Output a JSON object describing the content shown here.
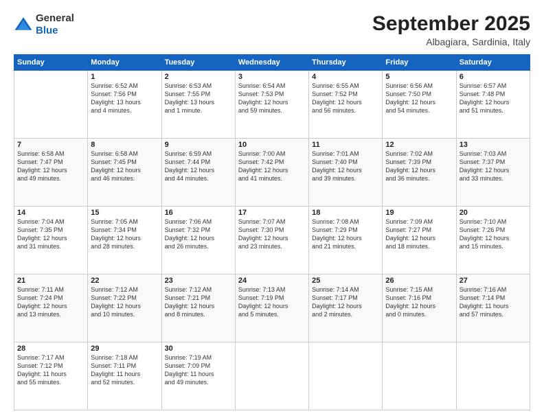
{
  "logo": {
    "line1": "General",
    "line2": "Blue"
  },
  "header": {
    "month": "September 2025",
    "location": "Albagiara, Sardinia, Italy"
  },
  "weekdays": [
    "Sunday",
    "Monday",
    "Tuesday",
    "Wednesday",
    "Thursday",
    "Friday",
    "Saturday"
  ],
  "weeks": [
    [
      {
        "day": "",
        "info": ""
      },
      {
        "day": "1",
        "info": "Sunrise: 6:52 AM\nSunset: 7:56 PM\nDaylight: 13 hours\nand 4 minutes."
      },
      {
        "day": "2",
        "info": "Sunrise: 6:53 AM\nSunset: 7:55 PM\nDaylight: 13 hours\nand 1 minute."
      },
      {
        "day": "3",
        "info": "Sunrise: 6:54 AM\nSunset: 7:53 PM\nDaylight: 12 hours\nand 59 minutes."
      },
      {
        "day": "4",
        "info": "Sunrise: 6:55 AM\nSunset: 7:52 PM\nDaylight: 12 hours\nand 56 minutes."
      },
      {
        "day": "5",
        "info": "Sunrise: 6:56 AM\nSunset: 7:50 PM\nDaylight: 12 hours\nand 54 minutes."
      },
      {
        "day": "6",
        "info": "Sunrise: 6:57 AM\nSunset: 7:48 PM\nDaylight: 12 hours\nand 51 minutes."
      }
    ],
    [
      {
        "day": "7",
        "info": "Sunrise: 6:58 AM\nSunset: 7:47 PM\nDaylight: 12 hours\nand 49 minutes."
      },
      {
        "day": "8",
        "info": "Sunrise: 6:58 AM\nSunset: 7:45 PM\nDaylight: 12 hours\nand 46 minutes."
      },
      {
        "day": "9",
        "info": "Sunrise: 6:59 AM\nSunset: 7:44 PM\nDaylight: 12 hours\nand 44 minutes."
      },
      {
        "day": "10",
        "info": "Sunrise: 7:00 AM\nSunset: 7:42 PM\nDaylight: 12 hours\nand 41 minutes."
      },
      {
        "day": "11",
        "info": "Sunrise: 7:01 AM\nSunset: 7:40 PM\nDaylight: 12 hours\nand 39 minutes."
      },
      {
        "day": "12",
        "info": "Sunrise: 7:02 AM\nSunset: 7:39 PM\nDaylight: 12 hours\nand 36 minutes."
      },
      {
        "day": "13",
        "info": "Sunrise: 7:03 AM\nSunset: 7:37 PM\nDaylight: 12 hours\nand 33 minutes."
      }
    ],
    [
      {
        "day": "14",
        "info": "Sunrise: 7:04 AM\nSunset: 7:35 PM\nDaylight: 12 hours\nand 31 minutes."
      },
      {
        "day": "15",
        "info": "Sunrise: 7:05 AM\nSunset: 7:34 PM\nDaylight: 12 hours\nand 28 minutes."
      },
      {
        "day": "16",
        "info": "Sunrise: 7:06 AM\nSunset: 7:32 PM\nDaylight: 12 hours\nand 26 minutes."
      },
      {
        "day": "17",
        "info": "Sunrise: 7:07 AM\nSunset: 7:30 PM\nDaylight: 12 hours\nand 23 minutes."
      },
      {
        "day": "18",
        "info": "Sunrise: 7:08 AM\nSunset: 7:29 PM\nDaylight: 12 hours\nand 21 minutes."
      },
      {
        "day": "19",
        "info": "Sunrise: 7:09 AM\nSunset: 7:27 PM\nDaylight: 12 hours\nand 18 minutes."
      },
      {
        "day": "20",
        "info": "Sunrise: 7:10 AM\nSunset: 7:26 PM\nDaylight: 12 hours\nand 15 minutes."
      }
    ],
    [
      {
        "day": "21",
        "info": "Sunrise: 7:11 AM\nSunset: 7:24 PM\nDaylight: 12 hours\nand 13 minutes."
      },
      {
        "day": "22",
        "info": "Sunrise: 7:12 AM\nSunset: 7:22 PM\nDaylight: 12 hours\nand 10 minutes."
      },
      {
        "day": "23",
        "info": "Sunrise: 7:12 AM\nSunset: 7:21 PM\nDaylight: 12 hours\nand 8 minutes."
      },
      {
        "day": "24",
        "info": "Sunrise: 7:13 AM\nSunset: 7:19 PM\nDaylight: 12 hours\nand 5 minutes."
      },
      {
        "day": "25",
        "info": "Sunrise: 7:14 AM\nSunset: 7:17 PM\nDaylight: 12 hours\nand 2 minutes."
      },
      {
        "day": "26",
        "info": "Sunrise: 7:15 AM\nSunset: 7:16 PM\nDaylight: 12 hours\nand 0 minutes."
      },
      {
        "day": "27",
        "info": "Sunrise: 7:16 AM\nSunset: 7:14 PM\nDaylight: 11 hours\nand 57 minutes."
      }
    ],
    [
      {
        "day": "28",
        "info": "Sunrise: 7:17 AM\nSunset: 7:12 PM\nDaylight: 11 hours\nand 55 minutes."
      },
      {
        "day": "29",
        "info": "Sunrise: 7:18 AM\nSunset: 7:11 PM\nDaylight: 11 hours\nand 52 minutes."
      },
      {
        "day": "30",
        "info": "Sunrise: 7:19 AM\nSunset: 7:09 PM\nDaylight: 11 hours\nand 49 minutes."
      },
      {
        "day": "",
        "info": ""
      },
      {
        "day": "",
        "info": ""
      },
      {
        "day": "",
        "info": ""
      },
      {
        "day": "",
        "info": ""
      }
    ]
  ]
}
